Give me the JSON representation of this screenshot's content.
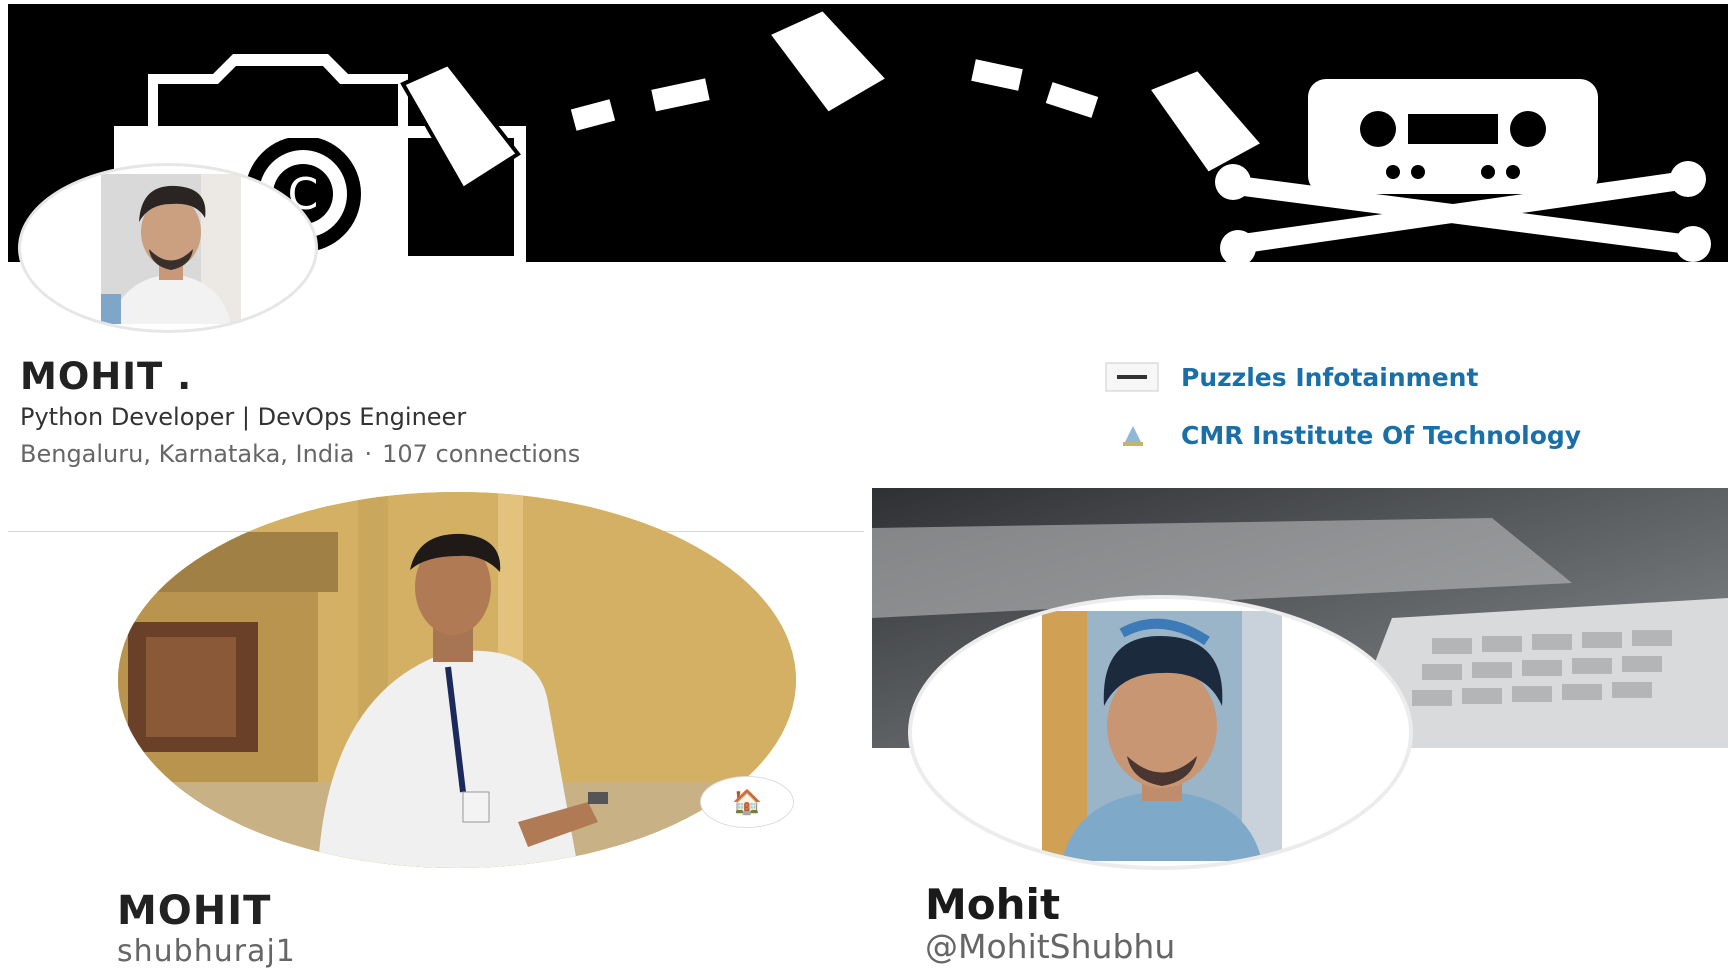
{
  "linkedin": {
    "name": "MOHIT .",
    "headline": "Python Developer | DevOps Engineer",
    "location": "Bengaluru, Karnataka, India",
    "separator": "·",
    "connections": "107 connections",
    "organizations": [
      {
        "label": "Puzzles Infotainment",
        "logo": "company-logo"
      },
      {
        "label": "CMR Institute Of Technology",
        "logo": "school-logo"
      }
    ],
    "banner_icons": [
      "camera-copyright-icon",
      "document-icon",
      "cassette-skull-crossbones-icon"
    ]
  },
  "github": {
    "name": "MOHIT",
    "login": "shubhuraj1",
    "status_emoji": "🏠"
  },
  "twitter": {
    "name": "Mohit",
    "handle": "@MohitShubhu"
  },
  "colors": {
    "link": "#1a6fa8",
    "banner_bg": "#000000",
    "text_primary": "#222222",
    "text_muted": "#666666"
  }
}
